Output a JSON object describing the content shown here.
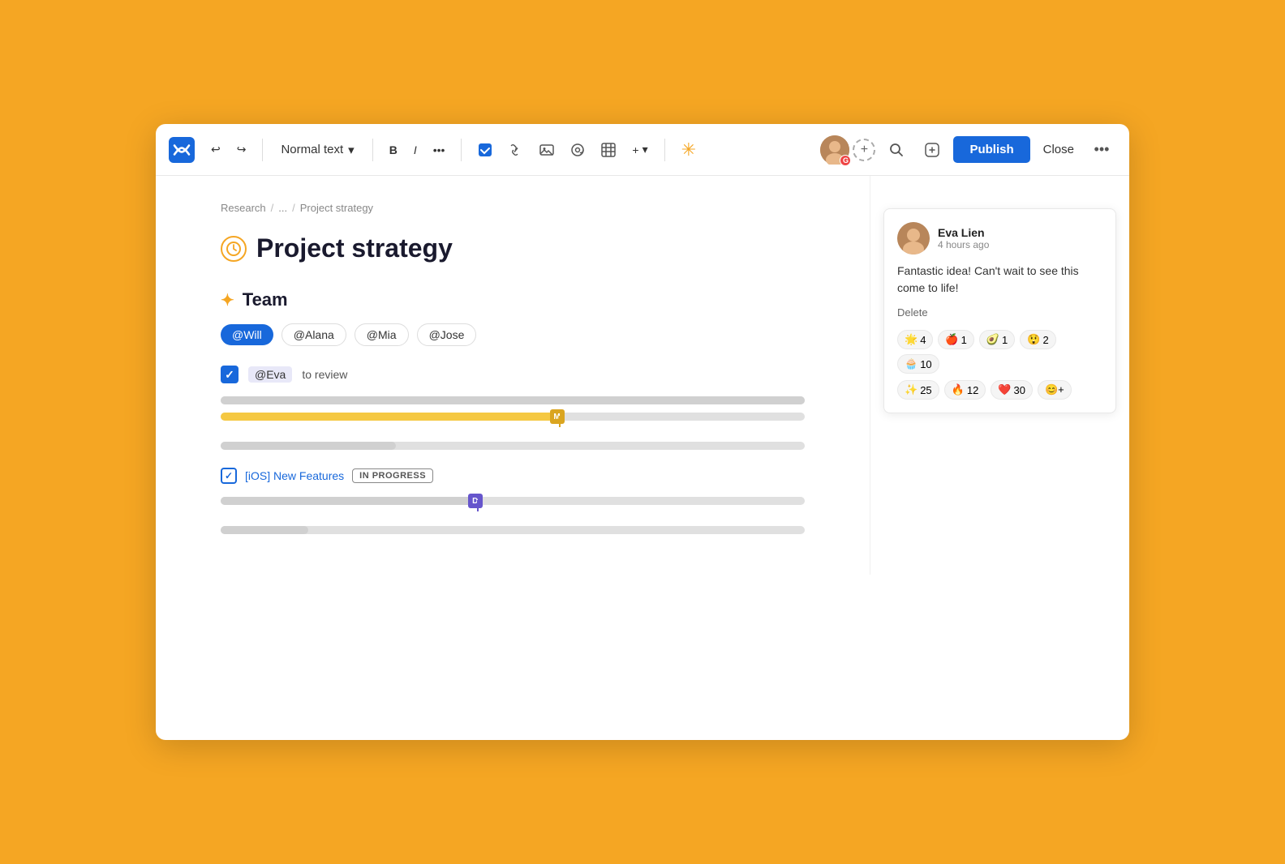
{
  "window": {
    "background_color": "#F5A623"
  },
  "toolbar": {
    "logo_alt": "Confluence logo",
    "undo_label": "↩",
    "redo_label": "↪",
    "text_style_label": "Normal text",
    "text_style_chevron": "▾",
    "bold_label": "B",
    "italic_label": "I",
    "more_label": "•••",
    "checkbox_label": "☑",
    "link_label": "🔗",
    "image_label": "🖼",
    "mention_label": "@",
    "table_label": "⊞",
    "insert_plus_label": "+",
    "insert_chevron": "▾",
    "ai_icon": "✳",
    "search_icon": "🔍",
    "edit_icon": "📝",
    "publish_label": "Publish",
    "close_label": "Close",
    "more_options_label": "•••"
  },
  "breadcrumb": {
    "items": [
      "Research",
      "/",
      "...",
      "/",
      "Project strategy"
    ]
  },
  "page": {
    "title": "Project strategy",
    "title_icon": "🕐",
    "sections": [
      {
        "heading": "Team",
        "heading_icon": "✦",
        "mentions": [
          {
            "name": "@Will",
            "style": "blue"
          },
          {
            "name": "@Alana",
            "style": "outlined"
          },
          {
            "name": "@Mia",
            "style": "outlined"
          },
          {
            "name": "@Jose",
            "style": "outlined"
          }
        ]
      }
    ],
    "task": {
      "checked": true,
      "assignee": "@Eva",
      "label": "to review"
    },
    "progress_bars": [
      {
        "fill_percent": 100,
        "has_cursor": false
      },
      {
        "fill_percent": 58,
        "has_cursor_m": true,
        "cursor_label": "M"
      },
      {
        "fill_percent": 30,
        "has_cursor": false
      }
    ],
    "ios_task": {
      "checked": true,
      "link_text": "[iOS] New Features",
      "badge": "IN PROGRESS"
    },
    "progress_bars_2": [
      {
        "fill_percent": 44,
        "has_cursor_d": true,
        "cursor_label": "D"
      },
      {
        "fill_percent": 15
      }
    ]
  },
  "comment": {
    "author": "Eva Lien",
    "time": "4 hours ago",
    "text": "Fantastic idea! Can't wait to see this come to life!",
    "delete_label": "Delete",
    "reactions": [
      {
        "emoji": "🌟",
        "count": 4
      },
      {
        "emoji": "🍎",
        "count": 1
      },
      {
        "emoji": "🥑",
        "count": 1
      },
      {
        "emoji": "😲",
        "count": 2
      },
      {
        "emoji": "🧁",
        "count": 10
      }
    ],
    "reactions_row2": [
      {
        "emoji": "✨",
        "count": 25
      },
      {
        "emoji": "🔥",
        "count": 12
      },
      {
        "emoji": "❤️",
        "count": 30
      }
    ]
  }
}
